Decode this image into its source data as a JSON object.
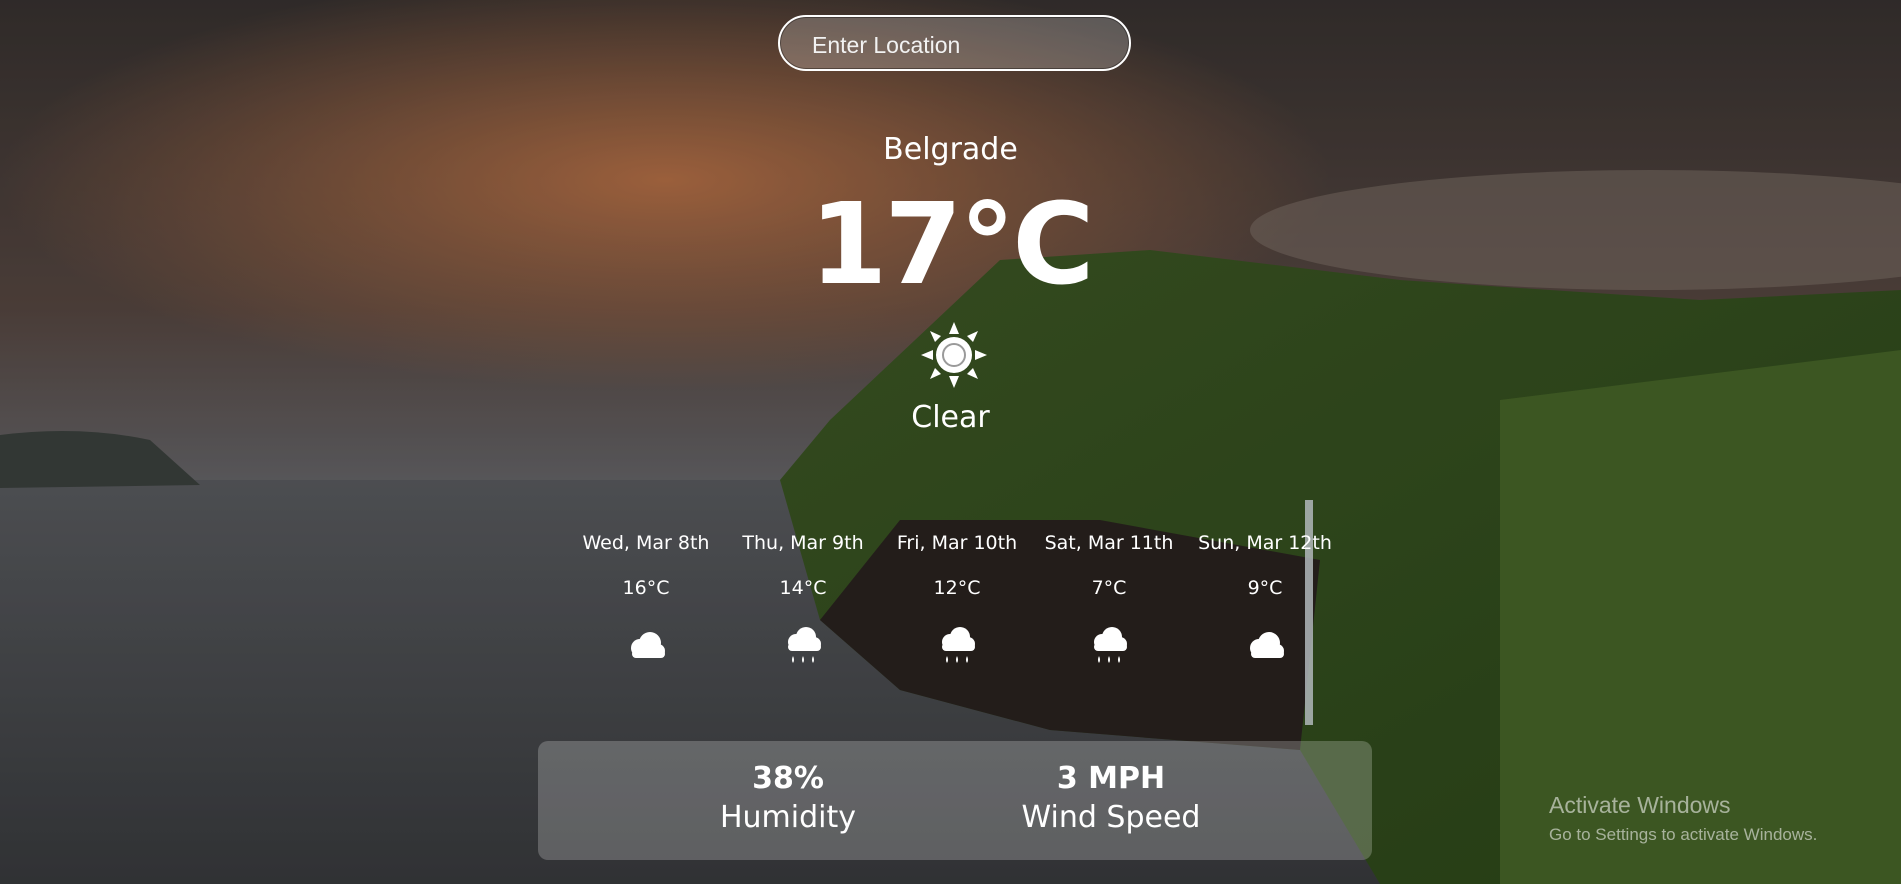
{
  "search": {
    "placeholder": "Enter Location"
  },
  "current": {
    "city": "Belgrade",
    "temperature": "17°C",
    "condition": "Clear",
    "icon": "sun-icon"
  },
  "forecast": [
    {
      "date": "Wed, Mar 8th",
      "temp": "16°C",
      "icon": "cloud-icon"
    },
    {
      "date": "Thu, Mar 9th",
      "temp": "14°C",
      "icon": "rain-cloud-icon"
    },
    {
      "date": "Fri, Mar 10th",
      "temp": "12°C",
      "icon": "rain-cloud-icon"
    },
    {
      "date": "Sat, Mar 11th",
      "temp": "7°C",
      "icon": "rain-cloud-icon"
    },
    {
      "date": "Sun, Mar 12th",
      "temp": "9°C",
      "icon": "cloud-icon"
    }
  ],
  "stats": {
    "humidity_value": "38%",
    "humidity_label": "Humidity",
    "wind_value": "3 MPH",
    "wind_label": "Wind Speed"
  },
  "watermark": {
    "title": "Activate Windows",
    "subtitle": "Go to Settings to activate Windows."
  }
}
